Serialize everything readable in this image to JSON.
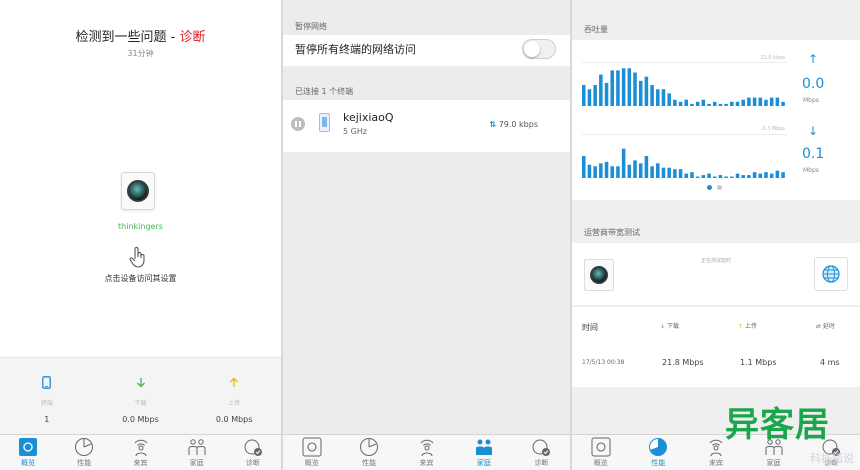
{
  "colors": {
    "accent": "#1a8fd6",
    "warning": "#e02020",
    "online": "#4caf50",
    "download": "#4caf50",
    "upload": "#f0b400",
    "watermark": "#1aa64a"
  },
  "overview": {
    "title_prefix": "检测到一些问题 - ",
    "title_link": "诊断",
    "elapsed": "31分钟",
    "device_name": "thinkingers",
    "tap_hint": "点击设备访问其设置",
    "stats": [
      {
        "label": "终端",
        "value": "1",
        "icon": "phone-icon"
      },
      {
        "label": "下载",
        "value": "0.0 Mbps",
        "icon": "download-arrow-icon"
      },
      {
        "label": "上传",
        "value": "0.0 Mbps",
        "icon": "upload-arrow-icon"
      }
    ]
  },
  "tabs": [
    {
      "label": "概览",
      "icon": "overview-icon"
    },
    {
      "label": "性能",
      "icon": "performance-icon"
    },
    {
      "label": "来宾",
      "icon": "guest-icon"
    },
    {
      "label": "家庭",
      "icon": "family-icon"
    },
    {
      "label": "诊断",
      "icon": "diagnose-icon"
    }
  ],
  "family": {
    "pause_section": "暂停网络",
    "pause_all_label": "暂停所有终端的网络访问",
    "pause_all_on": false,
    "connected_section": "已连接 1 个终端",
    "clients": [
      {
        "name": "kejixiaoQ",
        "band": "5 GHz",
        "rate": "79.0 kbps"
      }
    ]
  },
  "performance": {
    "throughput_title": "吞吐量",
    "upload_value": "0.0",
    "upload_unit": "Mbps",
    "download_value": "0.1",
    "download_unit": "Mbps",
    "up_chart_max": "21.0 kbps",
    "down_chart_max": "0.3 Mbps",
    "isp_title": "运营商带宽测试",
    "testing_text": "正在测试延时",
    "result_headers": {
      "time": "时间",
      "down": "下载",
      "up": "上传",
      "latency": "延时"
    },
    "result_row": {
      "time": "17/5/13 00:38",
      "down": "21.8 Mbps",
      "up": "1.1 Mbps",
      "latency": "4 ms"
    }
  },
  "chart_data": [
    {
      "type": "bar",
      "title": "",
      "ylim": [
        0,
        21
      ],
      "values": [
        10,
        8,
        10,
        15,
        11,
        17,
        17,
        18,
        18,
        16,
        12,
        14,
        10,
        8,
        8,
        6,
        3,
        2,
        3,
        1,
        2,
        3,
        1,
        2,
        1,
        1,
        2,
        2,
        3,
        4,
        4,
        4,
        3,
        4,
        4,
        2
      ]
    },
    {
      "type": "bar",
      "title": "",
      "ylim": [
        0,
        0.3
      ],
      "values": [
        0.15,
        0.09,
        0.08,
        0.1,
        0.11,
        0.08,
        0.08,
        0.2,
        0.09,
        0.12,
        0.1,
        0.15,
        0.08,
        0.1,
        0.07,
        0.07,
        0.06,
        0.06,
        0.03,
        0.04,
        0.01,
        0.02,
        0.03,
        0.01,
        0.02,
        0.01,
        0.01,
        0.03,
        0.02,
        0.02,
        0.04,
        0.03,
        0.04,
        0.03,
        0.05,
        0.04
      ]
    }
  ],
  "watermark": {
    "main": "异客居",
    "sub": "科技狐说"
  }
}
